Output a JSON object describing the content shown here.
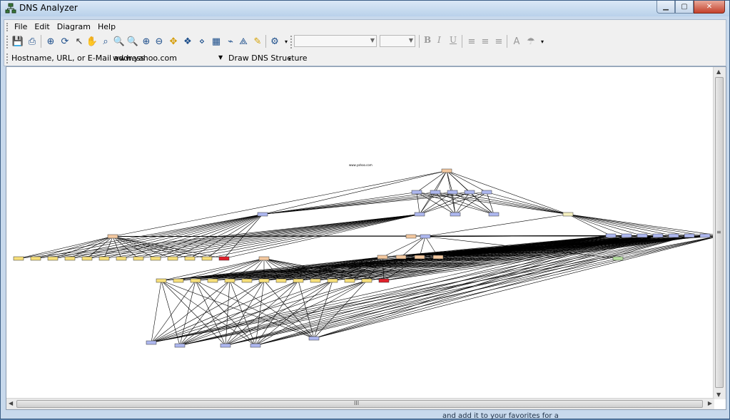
{
  "window": {
    "title": "DNS Analyzer"
  },
  "menu": {
    "file": "File",
    "edit": "Edit",
    "diagram": "Diagram",
    "help": "Help"
  },
  "format": {
    "bold": "B",
    "italic": "I",
    "underline": "U"
  },
  "address": {
    "label": "Hostname, URL, or E-Mail address",
    "value": "www.yahoo.com",
    "draw_button": "Draw DNS Structure"
  },
  "diagram": {
    "root_label": "www.yahoo.com",
    "colors": {
      "yellow": "#f7e07a",
      "orange": "#f4c9a0",
      "blue": "#aeb8f0",
      "red": "#e0202a",
      "edge": "#000000"
    }
  },
  "scroll": {
    "h_thumb_label": "III",
    "v_thumb_label": "≡"
  },
  "background_text": "and add it to your favorites for a"
}
